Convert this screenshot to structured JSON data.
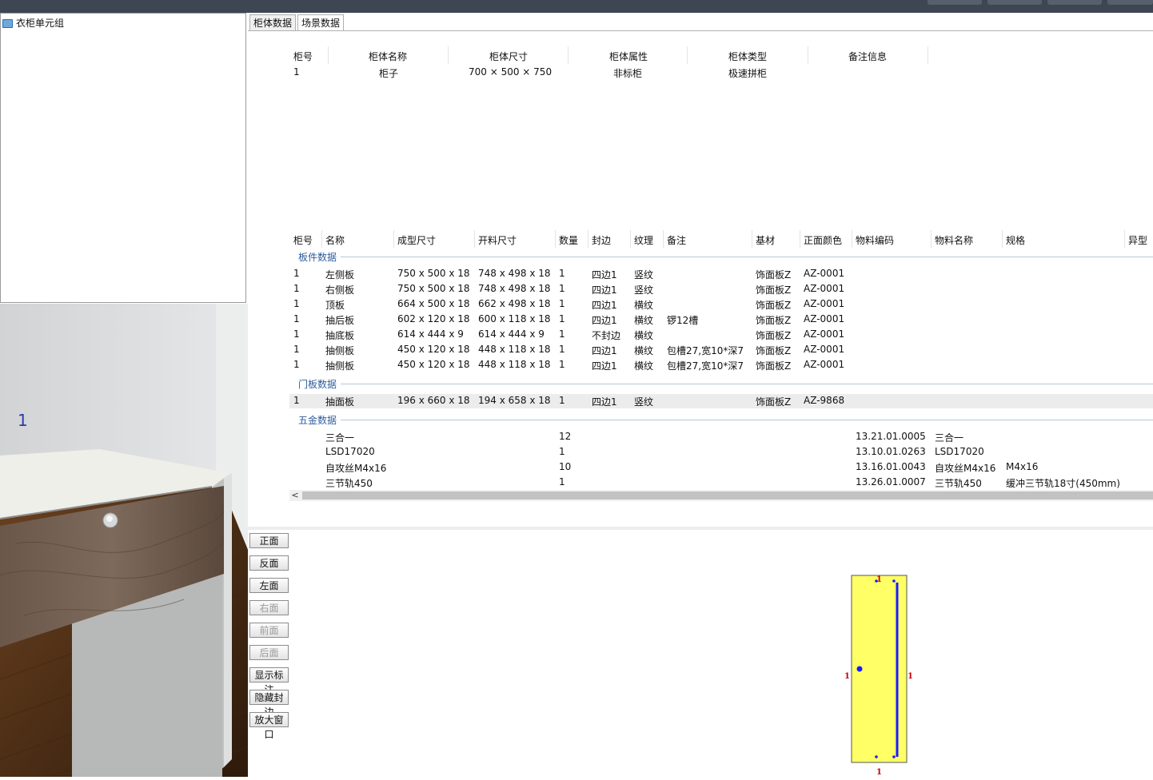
{
  "tree": {
    "root_label": "衣柜单元组"
  },
  "tabs": [
    {
      "label": "柜体数据"
    },
    {
      "label": "场景数据"
    }
  ],
  "cabinet_table": {
    "headers": [
      "柜号",
      "柜体名称",
      "柜体尺寸",
      "柜体属性",
      "柜体类型",
      "备注信息"
    ],
    "rows": [
      [
        "1",
        "柜子",
        "700 × 500 × 750",
        "非标柜",
        "极速拼柜",
        ""
      ]
    ]
  },
  "parts_table": {
    "headers": [
      "柜号",
      "名称",
      "成型尺寸",
      "开料尺寸",
      "数量",
      "封边",
      "纹理",
      "备注",
      "基材",
      "正面颜色",
      "物料编码",
      "物料名称",
      "规格",
      "异型"
    ],
    "groups": [
      {
        "label": "板件数据",
        "rows": [
          [
            "1",
            "左侧板",
            "750 x 500 x 18",
            "748 x 498 x 18",
            "1",
            "四边1",
            "竖纹",
            "",
            "饰面板Z",
            "AZ-0001",
            "",
            "",
            ""
          ],
          [
            "1",
            "右侧板",
            "750 x 500 x 18",
            "748 x 498 x 18",
            "1",
            "四边1",
            "竖纹",
            "",
            "饰面板Z",
            "AZ-0001",
            "",
            "",
            ""
          ],
          [
            "1",
            "顶板",
            "664 x 500 x 18",
            "662 x 498 x 18",
            "1",
            "四边1",
            "横纹",
            "",
            "饰面板Z",
            "AZ-0001",
            "",
            "",
            ""
          ],
          [
            "1",
            "抽后板",
            "602 x 120 x 18",
            "600 x 118 x 18",
            "1",
            "四边1",
            "横纹",
            "锣12槽",
            "饰面板Z",
            "AZ-0001",
            "",
            "",
            ""
          ],
          [
            "1",
            "抽底板",
            "614 x 444 x 9",
            "614 x 444 x 9",
            "1",
            "不封边",
            "横纹",
            "",
            "饰面板Z",
            "AZ-0001",
            "",
            "",
            ""
          ],
          [
            "1",
            "抽侧板",
            "450 x 120 x 18",
            "448 x 118 x 18",
            "1",
            "四边1",
            "横纹",
            "包槽27,宽10*深7",
            "饰面板Z",
            "AZ-0001",
            "",
            "",
            ""
          ],
          [
            "1",
            "抽侧板",
            "450 x 120 x 18",
            "448 x 118 x 18",
            "1",
            "四边1",
            "横纹",
            "包槽27,宽10*深7",
            "饰面板Z",
            "AZ-0001",
            "",
            "",
            ""
          ]
        ]
      },
      {
        "label": "门板数据",
        "rows": [
          [
            "1",
            "抽面板",
            "196 x 660 x 18",
            "194 x 658 x 18",
            "1",
            "四边1",
            "竖纹",
            "",
            "饰面板Z",
            "AZ-9868",
            "",
            "",
            ""
          ]
        ]
      },
      {
        "label": "五金数据",
        "rows": [
          [
            "",
            "三合一",
            "",
            "",
            "12",
            "",
            "",
            "",
            "",
            "",
            "13.21.01.0005",
            "三合一",
            ""
          ],
          [
            "",
            "LSD17020",
            "",
            "",
            "1",
            "",
            "",
            "",
            "",
            "",
            "13.10.01.0263",
            "LSD17020",
            ""
          ],
          [
            "",
            "自攻丝M4x16",
            "",
            "",
            "10",
            "",
            "",
            "",
            "",
            "",
            "13.16.01.0043",
            "自攻丝M4x16",
            "M4x16"
          ],
          [
            "",
            "三节轨450",
            "",
            "",
            "1",
            "",
            "",
            "",
            "",
            "",
            "13.26.01.0007",
            "三节轨450",
            "缓冲三节轨18寸(450mm)"
          ]
        ]
      }
    ],
    "scroll_arrow": "<"
  },
  "view_buttons": [
    {
      "label": "正面",
      "enabled": true
    },
    {
      "label": "反面",
      "enabled": true
    },
    {
      "label": "左面",
      "enabled": true
    },
    {
      "label": "右面",
      "enabled": false
    },
    {
      "label": "前面",
      "enabled": false
    },
    {
      "label": "后面",
      "enabled": false
    },
    {
      "label": "显示标注",
      "enabled": true
    },
    {
      "label": "隐藏封边",
      "enabled": true
    },
    {
      "label": "放大窗口",
      "enabled": true
    }
  ],
  "scene": {
    "cabinet_number": "1"
  },
  "panel_preview": {
    "marker": "1",
    "panel_color": "#ffff66",
    "groove_color": "#1a1aff",
    "marker_color": "#cc0000"
  },
  "colors": {
    "wood": "#5e4c40",
    "scene_number": "#2a3aa8"
  }
}
